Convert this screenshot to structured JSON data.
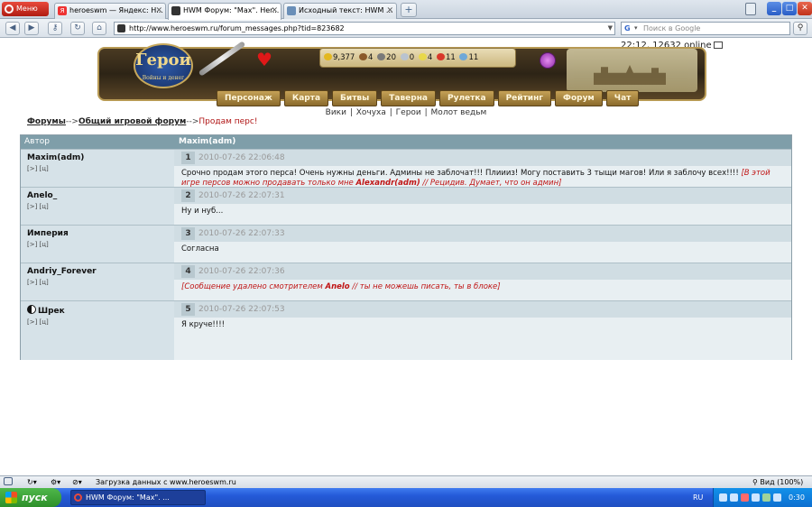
{
  "browser": {
    "menu_label": "Меню",
    "tabs": [
      {
        "title": "heroeswm — Яндекс: Н..."
      },
      {
        "title": "HWM Форум: \"Мах\". Her..."
      },
      {
        "title": "Исходный текст: HWM ..."
      }
    ],
    "url": "http://www.heroeswm.ru/forum_messages.php?tid=823682",
    "search_placeholder": "Поиск в Google"
  },
  "page": {
    "server_time": "22:12, 12632 online",
    "logo_text": "Герои",
    "logo_sub": "Войны и денег",
    "resources": [
      {
        "name": "gold",
        "value": "9,377"
      },
      {
        "name": "wood",
        "value": "4"
      },
      {
        "name": "ore",
        "value": "20"
      },
      {
        "name": "mercury",
        "value": "0"
      },
      {
        "name": "sulfur",
        "value": "4"
      },
      {
        "name": "crystal",
        "value": "11"
      },
      {
        "name": "gems",
        "value": "11"
      }
    ],
    "nav": [
      "Персонаж",
      "Карта",
      "Битвы",
      "Таверна",
      "Рулетка",
      "Рейтинг",
      "Форум",
      "Чат"
    ],
    "sub_links": [
      "Вики",
      "Хочуха",
      "Герои",
      "Молот ведьм"
    ],
    "breadcrumb": {
      "forums": "Форумы",
      "sep": "-->",
      "category": "Общий игровой форум",
      "current": "Продам перс!"
    },
    "table": {
      "col_author": "Автор",
      "col_topic": "Maxim(adm)"
    },
    "posts": [
      {
        "author": "Maxim(adm)",
        "links": "[>] [ц]",
        "num": "1",
        "date": "2010-07-26 22:06:48",
        "text": "Срочно продам этого перса! Очень нужны деньги. Админы не заблочат!!! Плиииз! Могу поставить 3 тыщи магов! Или я заблочу всех!!!! ",
        "note_pre": "[В этой игре персов можно продавать только мне ",
        "note_name": "Alexandr(adm)",
        "note_post": " // Рецидив. Думает, что он админ]"
      },
      {
        "author": "Anelo_",
        "links": "[>] [ц]",
        "num": "2",
        "date": "2010-07-26 22:07:31",
        "text": "Ну и нуб..."
      },
      {
        "author": "Империя",
        "links": "[>] [ц]",
        "num": "3",
        "date": "2010-07-26 22:07:33",
        "text": "Согласна"
      },
      {
        "author": "Andriy_Forever",
        "links": "[>] [ц]",
        "num": "4",
        "date": "2010-07-26 22:07:36",
        "note_pre": "[Сообщение удалено смотрителем ",
        "note_name": "Anelo",
        "note_post": " // ты не можешь писать, ты в блоке]"
      },
      {
        "author": "Шрек",
        "links": "[>] [ц]",
        "num": "5",
        "date": "2010-07-26 22:07:53",
        "text": "Я круче!!!!"
      }
    ]
  },
  "statusbar": {
    "loading": "Загрузка данных с www.heroeswm.ru",
    "zoom": "Вид (100%)"
  },
  "taskbar": {
    "start": "пуск",
    "task": "HWM Форум: \"Мах\". ...",
    "lang": "RU",
    "clock": "0:30"
  }
}
